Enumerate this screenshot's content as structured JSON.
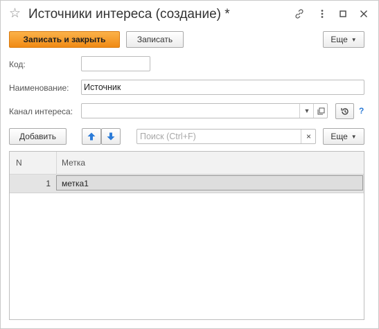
{
  "window": {
    "title": "Источники интереса (создание) *"
  },
  "toolbar": {
    "save_close_label": "Записать и закрыть",
    "save_label": "Записать",
    "more_label": "Еще"
  },
  "form": {
    "code_label": "Код:",
    "code_value": "",
    "name_label": "Наименование:",
    "name_value": "Источник",
    "channel_label": "Канал интереса:",
    "channel_value": "",
    "help_glyph": "?"
  },
  "table_toolbar": {
    "add_label": "Добавить",
    "search_placeholder": "Поиск (Ctrl+F)",
    "more_label": "Еще"
  },
  "table": {
    "columns": [
      "N",
      "Метка"
    ],
    "rows": [
      {
        "n": "1",
        "label": "метка1"
      }
    ]
  },
  "colors": {
    "primary_button": "#f08a14",
    "selected_row": "#e4e4e4",
    "help": "#2a7ad6"
  }
}
